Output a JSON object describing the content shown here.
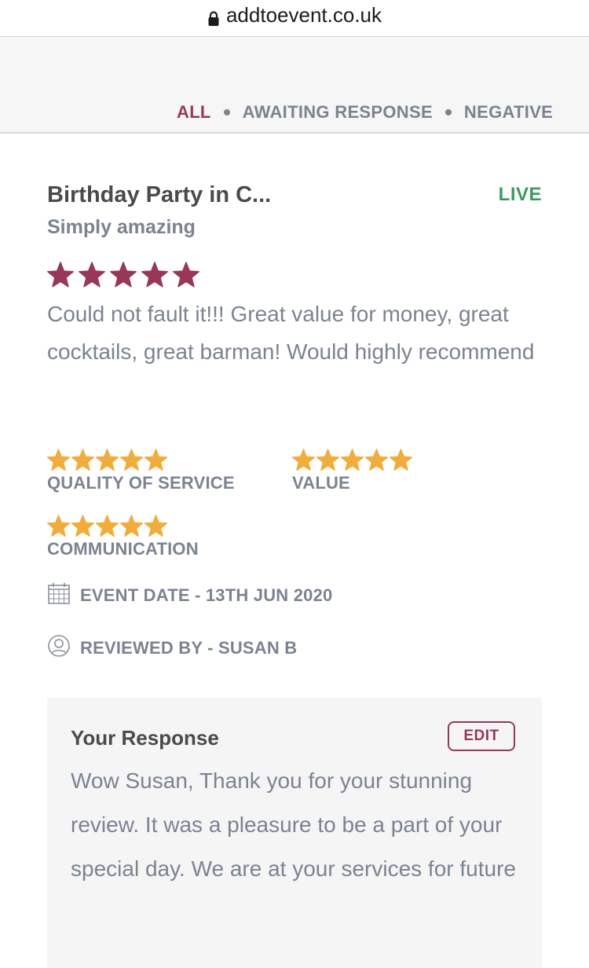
{
  "browser": {
    "url": "addtoevent.co.uk"
  },
  "filters": {
    "tabs": [
      {
        "label": "ALL",
        "active": true
      },
      {
        "label": "AWAITING RESPONSE",
        "active": false
      },
      {
        "label": "NEGATIVE",
        "active": false
      }
    ]
  },
  "review": {
    "title": "Birthday Party in C...",
    "status": "LIVE",
    "headline": "Simply amazing",
    "overall_rating": 5,
    "body": "Could not fault it!!! Great value for money, great cocktails, great barman! Would highly recommend",
    "ratings": [
      {
        "label": "QUALITY OF SERVICE",
        "stars": 5
      },
      {
        "label": "VALUE",
        "stars": 5
      },
      {
        "label": "COMMUNICATION",
        "stars": 5
      }
    ],
    "event_date": "EVENT DATE - 13TH JUN 2020",
    "reviewed_by": "REVIEWED BY - SUSAN B"
  },
  "response": {
    "title": "Your Response",
    "edit_label": "EDIT",
    "text": "Wow Susan, Thank you for your stunning review. It was a pleasure to be a part of your special day. We are at your services for future"
  },
  "colors": {
    "brand": "#98375a",
    "live": "#3d9a5f",
    "gold_star": "#f0ad3e",
    "muted_text": "#7b8392"
  },
  "icons": {
    "lock": "lock-icon",
    "calendar": "calendar-icon",
    "user": "user-icon",
    "star": "star-icon"
  }
}
